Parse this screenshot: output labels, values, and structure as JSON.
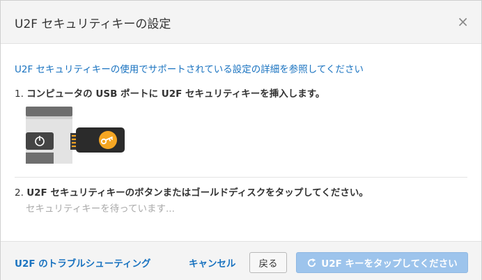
{
  "dialog": {
    "title": "U2F セキュリティキーの設定",
    "close_icon": "×"
  },
  "body": {
    "help_link": "U2F セキュリティキーの使用でサポートされている設定の詳細を参照してください",
    "step1": {
      "number": "1.",
      "text": "コンピュータの USB ポートに U2F セキュリティキーを挿入します。"
    },
    "step2": {
      "number": "2.",
      "text": "U2F セキュリティキーのボタンまたはゴールドディスクをタップしてください。"
    },
    "waiting": "セキュリティキーを待っています..."
  },
  "footer": {
    "troubleshoot_link": "U2F のトラブルシューティング",
    "cancel_label": "キャンセル",
    "back_label": "戻る",
    "primary_label": "U2F キーをタップしてください",
    "primary_icon": "refresh-icon",
    "primary_color": "#9dc4ec",
    "link_color": "#1a73c0"
  }
}
